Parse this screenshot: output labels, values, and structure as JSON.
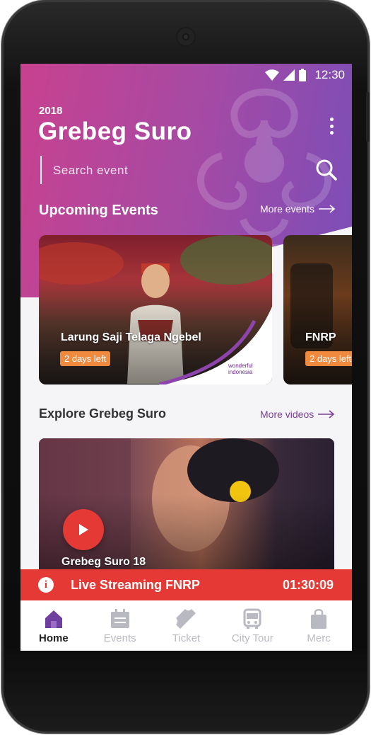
{
  "status_bar": {
    "time": "12:30"
  },
  "header": {
    "year": "2018",
    "title": "Grebeg Suro"
  },
  "search": {
    "placeholder": "Search event"
  },
  "upcoming": {
    "title": "Upcoming Events",
    "more_label": "More events",
    "events": [
      {
        "name": "Larung Saji Telaga Ngebel",
        "badge": "2 days left"
      },
      {
        "name": "FNRP",
        "badge": "2 days left"
      }
    ]
  },
  "brand_logo": {
    "text": "wonderful indonesia"
  },
  "explore": {
    "title": "Explore Grebeg Suro",
    "more_label": "More videos",
    "video_title": "Grebeg Suro 18"
  },
  "live": {
    "title": "Live Streaming FNRP",
    "time": "01:30:09"
  },
  "nav": {
    "items": [
      {
        "label": "Home",
        "icon": "home-icon",
        "active": true
      },
      {
        "label": "Events",
        "icon": "calendar-icon",
        "active": false
      },
      {
        "label": "Ticket",
        "icon": "ticket-icon",
        "active": false
      },
      {
        "label": "City Tour",
        "icon": "bus-icon",
        "active": false
      },
      {
        "label": "Merc",
        "icon": "shopping-bag-icon",
        "active": false
      }
    ]
  },
  "colors": {
    "header_start": "#c8418f",
    "header_end": "#7a4eb8",
    "badge": "#f08a3e",
    "live": "#e53935",
    "accent": "#7c3f9a",
    "nav_active": "#6e3f9f"
  }
}
